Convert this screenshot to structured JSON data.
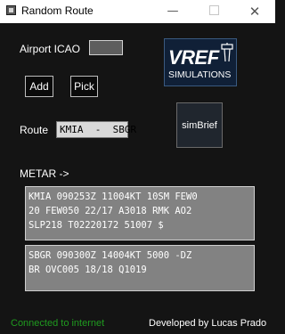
{
  "window": {
    "title": "Random Route",
    "minimize_glyph": "—",
    "close_glyph": "✕"
  },
  "form": {
    "airport_label": "Airport ICAO",
    "airport_value": "",
    "add_label": "Add",
    "pick_label": "Pick",
    "route_label": "Route",
    "route_value": "KMIA  -  SBGR"
  },
  "logos": {
    "vref_main": "VREF",
    "vref_sub": "SIMULATIONS",
    "simbrief": "simBrief"
  },
  "metar": {
    "label": "METAR ->",
    "departure_text": "KMIA 090253Z 11004KT 10SM FEW0\n20 FEW050 22/17 A3018 RMK AO2\nSLP218 T02220172 51007 $",
    "arrival_text": "SBGR 090300Z 14004KT 5000 -DZ\nBR OVC005 18/18 Q1019"
  },
  "footer": {
    "status": "Connected to internet",
    "developer": "Developed by Lucas Prado"
  },
  "colors": {
    "background": "#141414",
    "status_green": "#1f9a1f",
    "metar_box": "#828282"
  }
}
